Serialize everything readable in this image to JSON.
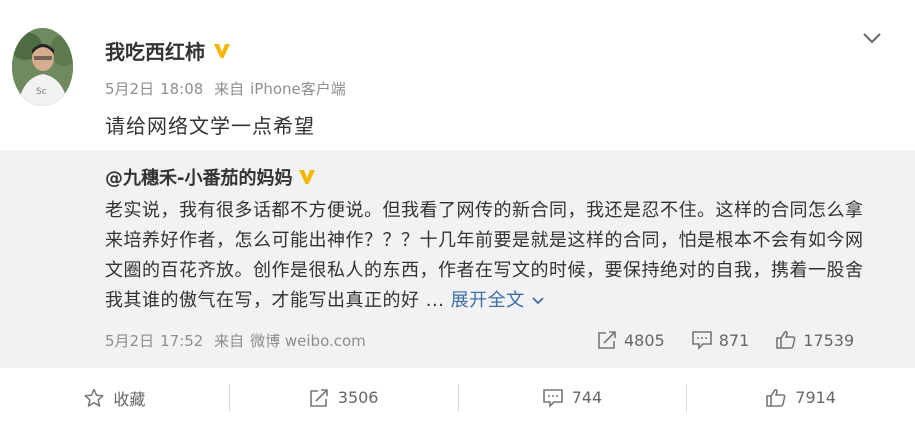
{
  "post": {
    "author": "我吃西红柿",
    "date": "5月2日",
    "time": "18:08",
    "source_prefix": "来自",
    "source": "iPhone客户端",
    "content": "请给网络文学一点希望"
  },
  "repost": {
    "author": "@九穗禾-小番茄的妈妈",
    "lines": [
      "老实说，我有很多话都不方便说。但我看了网传的新合同，我还是忍不住。这样的合同怎么拿",
      "来培养好作者，怎么可能出神作？？？十几年前要是就是这样的合同，怕是根本不会有如今网",
      "文圈的百花齐放。创作是很私人的东西，作者在写文的时候，要保持绝对的自我，携着一股舍",
      "我其谁的傲气在写，才能写出真正的好 ..."
    ],
    "expand_label": "展开全文",
    "date": "5月2日",
    "time": "17:52",
    "source_prefix": "来自",
    "source": "微博 weibo.com",
    "repost_count": "4805",
    "comment_count": "871",
    "like_count": "17539"
  },
  "toolbar": {
    "favorite_label": "收藏",
    "repost_count": "3506",
    "comment_count": "744",
    "like_count": "7914"
  },
  "colors": {
    "badge": "#f5b800",
    "link": "#3a6ea5",
    "repost_bg": "#f2f2f5",
    "meta_text": "#8e8e8e"
  },
  "icons": [
    "verified-badge",
    "chevron-down",
    "share",
    "comment",
    "thumbs-up",
    "star"
  ]
}
